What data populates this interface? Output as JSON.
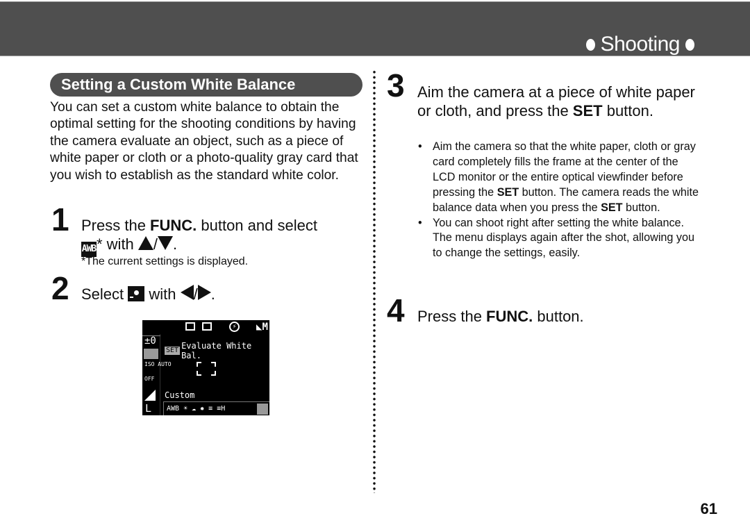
{
  "header": {
    "section_title": "Shooting"
  },
  "heading": "Setting a Custom White Balance",
  "intro": "You can set a custom white balance to obtain the optimal setting for the shooting conditions by having the camera evaluate an object, such as a piece of white paper or cloth or a photo-quality gray card that you wish to establish as the standard white color.",
  "steps": [
    {
      "number": "1",
      "line1_pre": "Press the ",
      "line1_bold": "FUNC.",
      "line1_post": " button and select",
      "icon_label": "AWB",
      "line2_post": "* with ",
      "slash": "/",
      "end": ".",
      "note": "*The current settings is displayed."
    },
    {
      "number": "2",
      "pre": "Select ",
      "mid": " with ",
      "slash": "/",
      "end": "."
    },
    {
      "number": "3",
      "text_pre": "Aim the camera at a piece of white paper or cloth, and press the ",
      "text_bold": "SET",
      "text_post": " button.",
      "bullets": [
        {
          "pre": "Aim the camera so that the white paper, cloth or gray card completely fills the frame at the center of the LCD monitor or the entire optical viewfinder before pressing the ",
          "bold": "SET",
          "mid": " button. The camera reads the white balance data when you press the ",
          "bold2": "SET",
          "post": " button."
        },
        {
          "text": "You can shoot right after setting the white balance. The menu displays again after the shot, allowing you to change the settings, easily."
        }
      ]
    },
    {
      "number": "4",
      "pre": "Press the ",
      "bold": "FUNC.",
      "post": " button."
    }
  ],
  "lcd": {
    "mode": "M",
    "flash": "⚡",
    "exposure": "±0",
    "iso": "ISO AUTO",
    "off": "OFF",
    "size": "L",
    "set_tag": "SET",
    "set_text": "Evaluate White Bal.",
    "current": "Custom",
    "strip": [
      "AWB",
      "☀",
      "☁",
      "✹",
      "≡",
      "≡H"
    ]
  },
  "page_number": "61"
}
